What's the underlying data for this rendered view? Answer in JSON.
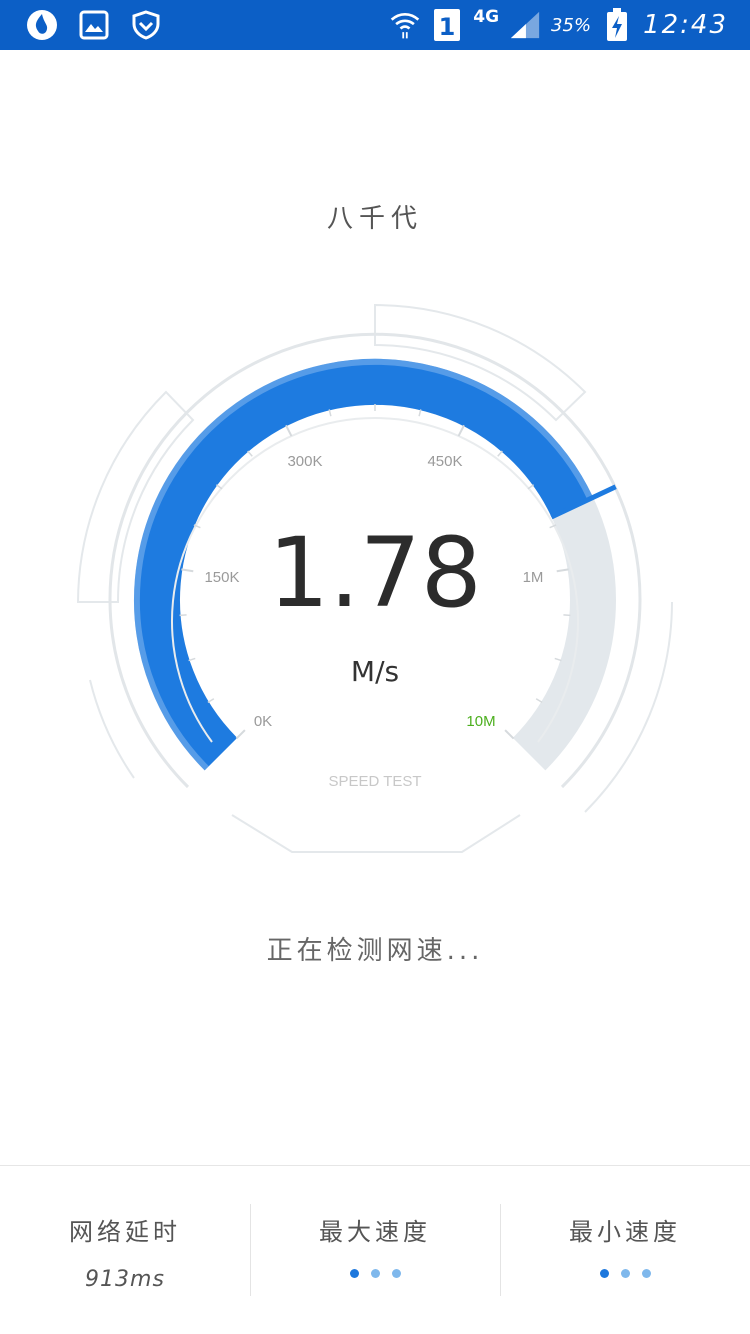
{
  "status_bar": {
    "network_type": "4G",
    "sim_slot": "1",
    "battery": "35%",
    "time": "12:43",
    "icons": [
      "browser-flame-icon",
      "gallery-icon",
      "shield-icon",
      "wifi-icon",
      "sim-icon",
      "signal-icon",
      "battery-charging-icon"
    ]
  },
  "title": "八千代",
  "gauge": {
    "tick_labels": {
      "t0": "0K",
      "t150": "150K",
      "t300": "300K",
      "t450": "450K",
      "t1m": "1M",
      "t10m": "10M"
    },
    "value": "1.78",
    "unit": "M/s",
    "caption": "SPEED TEST",
    "fill_fraction": 0.74,
    "accent_color": "#1e7be0",
    "track_color": "#e3e8ec",
    "max_label_color": "#4caf1e"
  },
  "status_text": "正在检测网速...",
  "footer": {
    "latency_label": "网络延时",
    "latency_value": "913ms",
    "max_speed_label": "最大速度",
    "min_speed_label": "最小速度"
  }
}
